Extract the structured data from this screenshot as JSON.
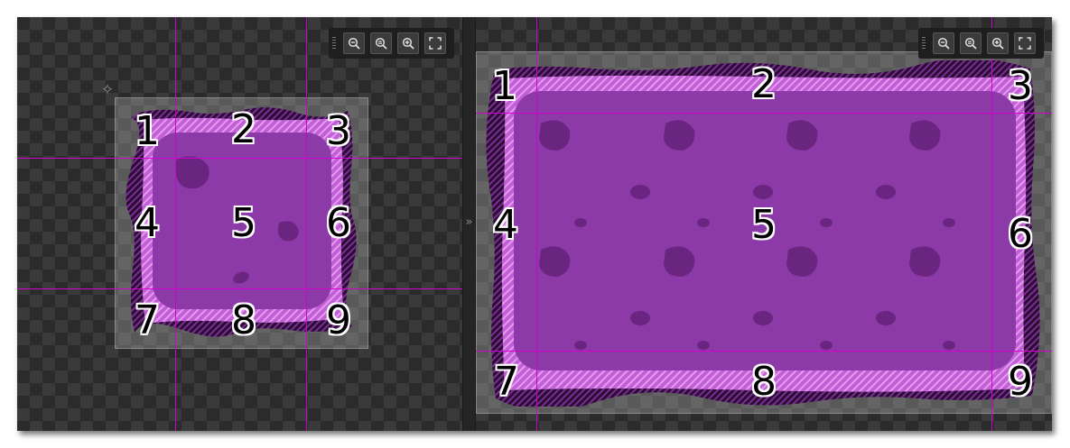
{
  "left_pane": {
    "slice_labels": [
      "1",
      "2",
      "3",
      "4",
      "5",
      "6",
      "7",
      "8",
      "9"
    ],
    "toolbar": {
      "icons": [
        "drag-handle-icon",
        "zoom-out-icon",
        "zoom-reset-icon",
        "zoom-in-icon",
        "fit-to-view-icon"
      ]
    }
  },
  "right_pane": {
    "slice_labels": [
      "1",
      "2",
      "3",
      "4",
      "5",
      "6",
      "7",
      "8",
      "9"
    ],
    "toolbar": {
      "icons": [
        "drag-handle-icon",
        "zoom-out-icon",
        "zoom-reset-icon",
        "zoom-in-icon",
        "fit-to-view-icon"
      ]
    }
  },
  "splitter": {
    "glyph": "»"
  },
  "colors": {
    "guide": "#d100d1",
    "sprite_fill": "#8b3aa7",
    "sprite_rim": "#d06be0",
    "sprite_border": "#4a1a5a",
    "spot": "#6a2580"
  }
}
